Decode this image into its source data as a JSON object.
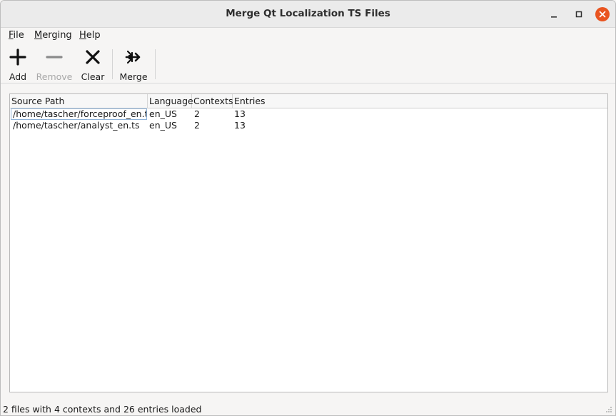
{
  "window": {
    "title": "Merge Qt Localization TS Files"
  },
  "menubar": [
    {
      "label": "File",
      "mnemonic": "F",
      "rest": "ile"
    },
    {
      "label": "Merging",
      "mnemonic": "M",
      "rest": "erging"
    },
    {
      "label": "Help",
      "mnemonic": "H",
      "rest": "elp"
    }
  ],
  "toolbar": {
    "add": {
      "label": "Add",
      "icon": "plus-icon",
      "enabled": true
    },
    "remove": {
      "label": "Remove",
      "icon": "minus-icon",
      "enabled": false
    },
    "clear": {
      "label": "Clear",
      "icon": "x-icon",
      "enabled": true
    },
    "merge": {
      "label": "Merge",
      "icon": "merge-arrows-icon",
      "enabled": true
    }
  },
  "table": {
    "columns": [
      "Source Path",
      "Language",
      "Contexts",
      "Entries"
    ],
    "rows": [
      [
        "/home/tascher/forceproof_en.ts",
        "en_US",
        "2",
        "13"
      ],
      [
        "/home/tascher/analyst_en.ts",
        "en_US",
        "2",
        "13"
      ]
    ]
  },
  "status": {
    "text": "2 files with 4 contexts and 26 entries loaded"
  },
  "colors": {
    "close_button": "#e95420",
    "disabled_text": "#a8a8a8",
    "focus_border": "#8fb3d9"
  }
}
